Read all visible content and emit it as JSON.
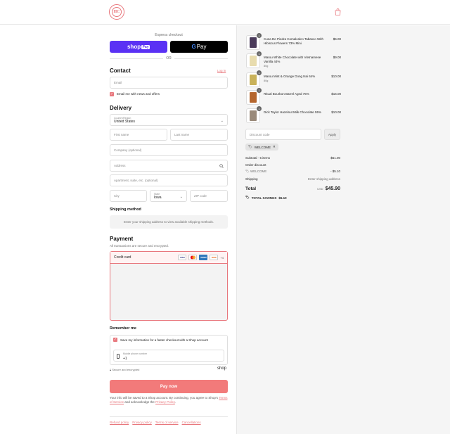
{
  "header": {
    "logo_text": "HC",
    "cart_icon": "shopping-bag-icon"
  },
  "express": {
    "label": "Express checkout",
    "shop_pay": "shop",
    "shop_pay_badge": "Pay",
    "gpay_g": "G",
    "gpay": "Pay",
    "or": "OR"
  },
  "contact": {
    "heading": "Contact",
    "login": "Log in",
    "email_placeholder": "Email",
    "news_label": "Email me with news and offers"
  },
  "delivery": {
    "heading": "Delivery",
    "country_label": "Country/Region",
    "country_value": "United States",
    "first_name": "First name",
    "last_name": "Last name",
    "company": "Company (optional)",
    "address": "Address",
    "apartment": "Apartment, suite, etc. (optional)",
    "city": "City",
    "state_label": "State",
    "state_value": "Iowa",
    "zip": "ZIP code"
  },
  "shipping": {
    "heading": "Shipping method",
    "message": "Enter your shipping address to view available shipping methods."
  },
  "payment": {
    "heading": "Payment",
    "subtitle": "All transactions are secure and encrypted.",
    "method": "Credit card",
    "cards": [
      "VISA",
      "MC",
      "AMEX",
      "DISC"
    ],
    "more_cards": "+4"
  },
  "remember": {
    "heading": "Remember me",
    "save_label": "Save my information for a faster checkout with a Shop account",
    "phone_label": "Mobile phone number",
    "phone_value": "+1",
    "secure": "Secure and encrypted",
    "shop_brand": "shop"
  },
  "pay_now": "Pay now",
  "terms": {
    "text1": "Your info will be saved to a Shop account. By continuing, you agree to Shop's",
    "tos_link": "Terms of Service",
    "text2": "and acknowledge the",
    "privacy_link": "Privacy Policy",
    "end": "."
  },
  "footer_links": [
    "Refund policy",
    "Privacy policy",
    "Terms of service",
    "Cancellations"
  ],
  "cart": {
    "items": [
      {
        "qty": "1",
        "name": "Cuna De Piedra Comalcalco Tabasco With Hibiscus Flowers 73% Mini",
        "variant": "",
        "price": "$6.00",
        "color": "#4a3a5a"
      },
      {
        "qty": "1",
        "name": "Marou White Chocolate with Vietnamese Vanilla 44%",
        "variant": "80g",
        "price": "$9.00",
        "color": "#e8dcae"
      },
      {
        "qty": "1",
        "name": "Marou Mint & Orange Dong Nai 64%",
        "variant": "80g",
        "price": "$10.00",
        "color": "#c9b25a"
      },
      {
        "qty": "1",
        "name": "Ritual Bourbon Barrel Aged 75%",
        "variant": "",
        "price": "$16.00",
        "color": "#b5662e"
      },
      {
        "qty": "1",
        "name": "Dick Taylor Hazelnut Milk Chocolate 55%",
        "variant": "",
        "price": "$10.00",
        "color": "#9a8a7a"
      }
    ],
    "discount_placeholder": "Discount code",
    "apply": "Apply",
    "tag": "WELCOME",
    "subtotal_label": "Subtotal · 5 items",
    "subtotal_value": "$51.00",
    "order_discount_label": "Order discount",
    "discount_code": "WELCOME",
    "discount_value": "- $5.10",
    "shipping_label": "Shipping",
    "shipping_value": "Enter shipping address",
    "total_label": "Total",
    "currency": "USD",
    "total_value": "$45.90",
    "savings_label": "TOTAL SAVINGS",
    "savings_value": "$5.10"
  },
  "colors": {
    "accent": "#e8777d",
    "pay_button": "#f27a7a",
    "shop_pay": "#5a31f4"
  }
}
